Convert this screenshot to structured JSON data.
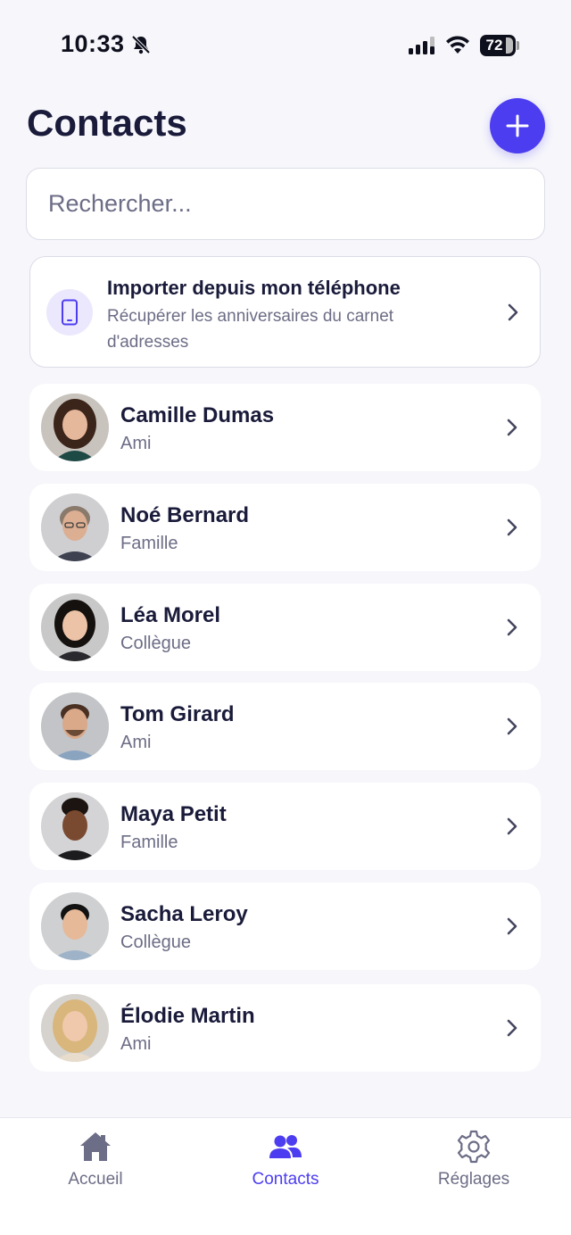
{
  "status_bar": {
    "time": "10:33",
    "battery": "72",
    "icons": [
      "bell-off-icon",
      "signal-icon",
      "wifi-icon",
      "battery-icon"
    ]
  },
  "header": {
    "title": "Contacts",
    "add_icon": "plus-icon"
  },
  "search": {
    "placeholder": "Rechercher...",
    "value": ""
  },
  "import_card": {
    "title": "Importer depuis mon téléphone",
    "subtitle": "Récupérer les anniversaires du carnet d'adresses",
    "icon": "phone-icon"
  },
  "contacts": [
    {
      "name": "Camille Dumas",
      "relation": "Ami"
    },
    {
      "name": "Noé Bernard",
      "relation": "Famille"
    },
    {
      "name": "Léa Morel",
      "relation": "Collègue"
    },
    {
      "name": "Tom Girard",
      "relation": "Ami"
    },
    {
      "name": "Maya Petit",
      "relation": "Famille"
    },
    {
      "name": "Sacha Leroy",
      "relation": "Collègue"
    },
    {
      "name": "Élodie Martin",
      "relation": "Ami"
    }
  ],
  "bottom_nav": {
    "items": [
      {
        "label": "Accueil",
        "icon": "home-icon"
      },
      {
        "label": "Contacts",
        "icon": "users-icon",
        "active": true
      },
      {
        "label": "Réglages",
        "icon": "gear-icon"
      }
    ]
  },
  "colors": {
    "accent": "#4c3df0",
    "background": "#f6f6fb",
    "text_primary": "#1a1b3a",
    "text_secondary": "#6c6d86",
    "nav_inactive": "#6c6d86"
  }
}
